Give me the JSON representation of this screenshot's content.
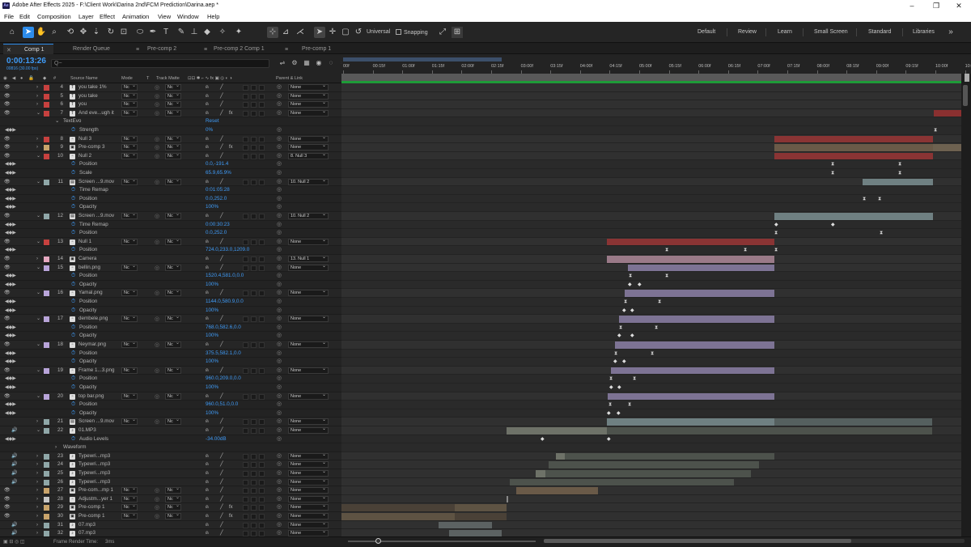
{
  "app": {
    "title": "Adobe After Effects 2025 - F:\\Client Work\\Darina 2nd\\FCM Prediction\\Darina.aep *"
  },
  "menu": [
    "File",
    "Edit",
    "Composition",
    "Layer",
    "Effect",
    "Animation",
    "View",
    "Window",
    "Help"
  ],
  "toolbar": {
    "universal_label": "Universal",
    "snapping_label": "Snapping"
  },
  "workspaces": [
    "Default",
    "Review",
    "Learn",
    "Small Screen",
    "Standard",
    "Libraries"
  ],
  "tabs": [
    {
      "label": "Comp 1",
      "active": true
    },
    {
      "label": "Render Queue",
      "active": false
    },
    {
      "label": "Pre-comp 2",
      "active": false
    },
    {
      "label": "Pre-comp 2 Comp 1",
      "active": false
    },
    {
      "label": "Pre-comp 1",
      "active": false
    }
  ],
  "timecode": {
    "value": "0:00:13:26",
    "frames": "00816 (30.00 fps)"
  },
  "search": {
    "placeholder": "Q~"
  },
  "column_headers": {
    "source_name": "Source Name",
    "mode": "Mode",
    "t": "T",
    "track_matte": "Track Matte",
    "parent": "Parent & Link"
  },
  "ruler": [
    "00f",
    "00:15f",
    "01:00f",
    "01:15f",
    "02:00f",
    "02:15f",
    "03:00f",
    "03:15f",
    "04:00f",
    "04:15f",
    "05:00f",
    "05:15f",
    "06:00f",
    "06:15f",
    "07:00f",
    "07:15f",
    "08:00f",
    "08:15f",
    "09:00f",
    "09:15f",
    "10:00f",
    "10:1"
  ],
  "status": {
    "frame_render_time": "Frame Render Time:",
    "frame_render_value": "3ms"
  },
  "layers": [
    {
      "type": "layer",
      "num": "4",
      "color": "#c7413f",
      "icon": "T",
      "name": "you take 1%",
      "mode": "Nc",
      "tm": "Nc",
      "parent": "None"
    },
    {
      "type": "layer",
      "num": "5",
      "color": "#c7413f",
      "icon": "T",
      "name": "you take",
      "mode": "Nc",
      "tm": "Nc",
      "parent": "None"
    },
    {
      "type": "layer",
      "num": "6",
      "color": "#c7413f",
      "icon": "T",
      "name": "you",
      "mode": "Nc",
      "tm": "Nc",
      "parent": "None"
    },
    {
      "type": "layer",
      "num": "7",
      "color": "#c7413f",
      "icon": "T",
      "name": "And eve...ugh it",
      "mode": "Nc",
      "tm": "Nc",
      "parent": "None",
      "fx": true,
      "open": true
    },
    {
      "type": "effect",
      "name": "TextEvo",
      "value": "Reset"
    },
    {
      "type": "prop",
      "name": "Strength",
      "value": "0%"
    },
    {
      "type": "layer",
      "num": "8",
      "color": "#c7413f",
      "icon": "▫",
      "name": "Null 3",
      "mode": "Nc",
      "tm": "Nc",
      "parent": "None"
    },
    {
      "type": "layer",
      "num": "9",
      "color": "#c9a46b",
      "icon": "▣",
      "name": "Pre-comp 3",
      "mode": "Nc",
      "tm": "Nc",
      "parent": "None",
      "fx": true
    },
    {
      "type": "layer",
      "num": "10",
      "color": "#c7413f",
      "icon": "▫",
      "name": "Null 2",
      "mode": "Nc",
      "tm": "Nc",
      "parent": "8. Null 3",
      "open": true
    },
    {
      "type": "prop",
      "name": "Position",
      "value": "0.0,-191.4"
    },
    {
      "type": "prop",
      "name": "Scale",
      "value": "65.9,65.9%"
    },
    {
      "type": "layer",
      "num": "11",
      "color": "#8fa7a8",
      "icon": "▤",
      "name": "Screen ...9.mov",
      "mode": "Nc",
      "tm": "Nc",
      "parent": "10. Null 2",
      "open": true
    },
    {
      "type": "prop",
      "name": "Time Remap",
      "value": "0:01:05:28"
    },
    {
      "type": "prop",
      "name": "Position",
      "value": "0.0,252.0"
    },
    {
      "type": "prop",
      "name": "Opacity",
      "value": "100%"
    },
    {
      "type": "layer",
      "num": "12",
      "color": "#8fa7a8",
      "icon": "▤",
      "name": "Screen ...9.mov",
      "mode": "Nc",
      "tm": "Nc",
      "parent": "10. Null 2",
      "open": true
    },
    {
      "type": "prop",
      "name": "Time Remap",
      "value": "0:00:30:23"
    },
    {
      "type": "prop",
      "name": "Position",
      "value": "0.0,252.0"
    },
    {
      "type": "layer",
      "num": "13",
      "color": "#c7413f",
      "icon": "▫",
      "name": "Null 1",
      "mode": "Nc",
      "tm": "Nc",
      "parent": "None",
      "open": true
    },
    {
      "type": "prop",
      "name": "Position",
      "value": "724.0,233.0,1209.0"
    },
    {
      "type": "layer",
      "num": "14",
      "color": "#e5a8c0",
      "icon": "▣",
      "name": "Camera",
      "mode": "",
      "tm": "",
      "parent": "13. Null 1"
    },
    {
      "type": "layer",
      "num": "15",
      "color": "#b8a4d9",
      "icon": "▫",
      "name": "bellin.png",
      "mode": "Nc",
      "tm": "Nc",
      "parent": "None",
      "open": true
    },
    {
      "type": "prop",
      "name": "Position",
      "value": "1520.4,581.0,0.0"
    },
    {
      "type": "prop",
      "name": "Opacity",
      "value": "100%"
    },
    {
      "type": "layer",
      "num": "16",
      "color": "#b8a4d9",
      "icon": "▫",
      "name": "Yamal.png",
      "mode": "Nc",
      "tm": "Nc",
      "parent": "None",
      "open": true
    },
    {
      "type": "prop",
      "name": "Position",
      "value": "1144.0,580.9,0.0"
    },
    {
      "type": "prop",
      "name": "Opacity",
      "value": "100%"
    },
    {
      "type": "layer",
      "num": "17",
      "color": "#b8a4d9",
      "icon": "▫",
      "name": "dembele.png",
      "mode": "Nc",
      "tm": "Nc",
      "parent": "None",
      "open": true
    },
    {
      "type": "prop",
      "name": "Position",
      "value": "768.0,582.6,0.0"
    },
    {
      "type": "prop",
      "name": "Opacity",
      "value": "100%"
    },
    {
      "type": "layer",
      "num": "18",
      "color": "#b8a4d9",
      "icon": "▫",
      "name": "Neymar.png",
      "mode": "Nc",
      "tm": "Nc",
      "parent": "None",
      "open": true
    },
    {
      "type": "prop",
      "name": "Position",
      "value": "375.5,582.1,0.0"
    },
    {
      "type": "prop",
      "name": "Opacity",
      "value": "100%"
    },
    {
      "type": "layer",
      "num": "19",
      "color": "#b8a4d9",
      "icon": "▫",
      "name": "Frame 1...3.png",
      "mode": "Nc",
      "tm": "Nc",
      "parent": "None",
      "open": true
    },
    {
      "type": "prop",
      "name": "Position",
      "value": "960.0,209.0,0.0"
    },
    {
      "type": "prop",
      "name": "Opacity",
      "value": "100%"
    },
    {
      "type": "layer",
      "num": "20",
      "color": "#b8a4d9",
      "icon": "▫",
      "name": "top bar.png",
      "mode": "Nc",
      "tm": "Nc",
      "parent": "None",
      "open": true
    },
    {
      "type": "prop",
      "name": "Position",
      "value": "960.0,51.0,0.0"
    },
    {
      "type": "prop",
      "name": "Opacity",
      "value": "100%"
    },
    {
      "type": "layer",
      "num": "21",
      "color": "#8fa7a8",
      "icon": "▤",
      "name": "Screen ...9.mov",
      "mode": "Nc",
      "tm": "Nc",
      "parent": "None",
      "noeye": true
    },
    {
      "type": "layer",
      "num": "22",
      "color": "#8fa7a8",
      "icon": "♪",
      "name": "01.MP3",
      "mode": "",
      "tm": "",
      "parent": "None",
      "audio": true,
      "open": true
    },
    {
      "type": "prop",
      "name": "Audio Levels",
      "value": "-34.00dB"
    },
    {
      "type": "effect",
      "name": "Waveform",
      "value": ""
    },
    {
      "type": "layer",
      "num": "23",
      "color": "#8fa7a8",
      "icon": "♪",
      "name": "Typewri...mp3",
      "mode": "",
      "tm": "",
      "parent": "None",
      "audio": true
    },
    {
      "type": "layer",
      "num": "24",
      "color": "#8fa7a8",
      "icon": "♪",
      "name": "Typewri...mp3",
      "mode": "",
      "tm": "",
      "parent": "None",
      "audio": true
    },
    {
      "type": "layer",
      "num": "25",
      "color": "#8fa7a8",
      "icon": "♪",
      "name": "Typewri...mp3",
      "mode": "",
      "tm": "",
      "parent": "None",
      "audio": true
    },
    {
      "type": "layer",
      "num": "26",
      "color": "#8fa7a8",
      "icon": "♪",
      "name": "Typewri...mp3",
      "mode": "",
      "tm": "",
      "parent": "None",
      "audio": true
    },
    {
      "type": "layer",
      "num": "27",
      "color": "#c9a46b",
      "icon": "▣",
      "name": "Pre-com...mp 1",
      "mode": "Nc",
      "tm": "Nc",
      "parent": "None"
    },
    {
      "type": "layer",
      "num": "28",
      "color": "#c7c7c7",
      "icon": "▫",
      "name": "Adjustm...yer 1",
      "mode": "Nc",
      "tm": "Nc",
      "parent": "None"
    },
    {
      "type": "layer",
      "num": "29",
      "color": "#c9a46b",
      "icon": "▣",
      "name": "Pre-comp 1",
      "mode": "Nc",
      "tm": "Nc",
      "parent": "None",
      "fx": true
    },
    {
      "type": "layer",
      "num": "30",
      "color": "#c9a46b",
      "icon": "▣",
      "name": "Pre-comp 1",
      "mode": "Nc",
      "tm": "Nc",
      "parent": "None",
      "fx": true
    },
    {
      "type": "layer",
      "num": "31",
      "color": "#8fa7a8",
      "icon": "♪",
      "name": "07.mp3",
      "mode": "",
      "tm": "",
      "parent": "None",
      "audio": true
    },
    {
      "type": "layer",
      "num": "32",
      "color": "#8fa7a8",
      "icon": "♪",
      "name": "07.mp3",
      "mode": "",
      "tm": "",
      "parent": "None",
      "audio": true
    }
  ]
}
